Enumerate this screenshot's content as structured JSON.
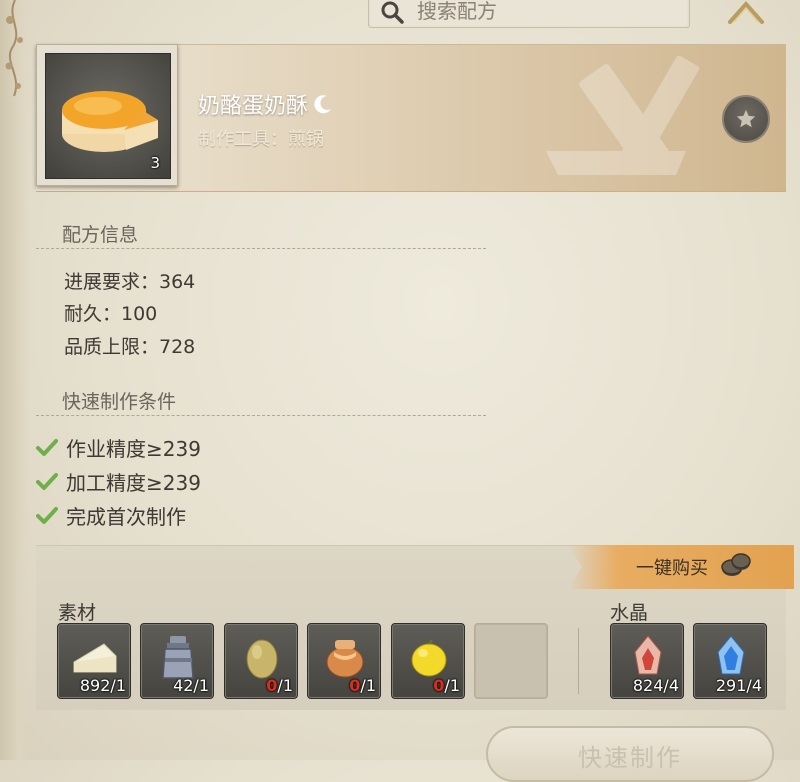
{
  "search": {
    "placeholder": "搜索配方"
  },
  "item": {
    "name": "奶酪蛋奶酥",
    "tool": "制作工具：煎锅",
    "count": "3"
  },
  "recipe_info": {
    "title": "配方信息",
    "lines": [
      "进展要求：364",
      "耐久：100",
      "品质上限：728"
    ]
  },
  "quick_craft": {
    "title": "快速制作条件",
    "conditions": [
      "作业精度≥239",
      "加工精度≥239",
      "完成首次制作"
    ]
  },
  "buy_all_label": "一键购买",
  "materials_label": "素材",
  "crystals_label": "水晶",
  "materials": [
    {
      "icon": "cheese-icon",
      "have": "892",
      "need": "/1"
    },
    {
      "icon": "milk-can-icon",
      "have": "42",
      "need": "/1"
    },
    {
      "icon": "egg-icon",
      "have": "0",
      "need": "/1"
    },
    {
      "icon": "honey-jar-icon",
      "have": "0",
      "need": "/1"
    },
    {
      "icon": "lemon-icon",
      "have": "0",
      "need": "/1"
    }
  ],
  "crystals": [
    {
      "icon": "fire-crystal-icon",
      "have": "824",
      "need": "/4"
    },
    {
      "icon": "water-crystal-icon",
      "have": "291",
      "need": "/4"
    }
  ],
  "craft_button_label": "快速制作",
  "colors": {
    "accent": "#e8ad62",
    "insufficient": "#e02a1a",
    "check": "#6fae4a"
  }
}
